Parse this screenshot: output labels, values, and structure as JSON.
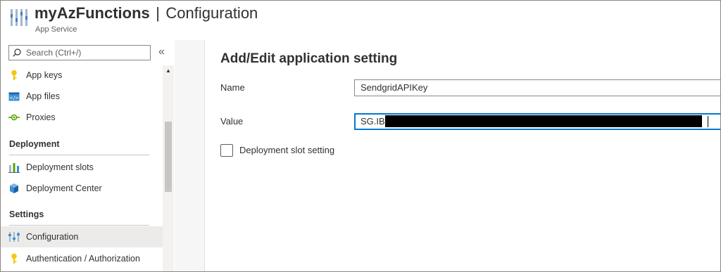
{
  "header": {
    "app_name": "myAzFunctions",
    "separator": "|",
    "page_name": "Configuration",
    "subtitle": "App Service"
  },
  "sidebar": {
    "search_placeholder": "Search (Ctrl+/)",
    "collapse_glyph": "«",
    "items_top": [
      {
        "label": "App keys",
        "icon": "key-icon"
      },
      {
        "label": "App files",
        "icon": "code-file-icon"
      },
      {
        "label": "Proxies",
        "icon": "proxy-icon"
      }
    ],
    "sections": [
      {
        "title": "Deployment",
        "items": [
          {
            "label": "Deployment slots",
            "icon": "deployment-slots-icon"
          },
          {
            "label": "Deployment Center",
            "icon": "deployment-center-icon"
          }
        ]
      },
      {
        "title": "Settings",
        "items": [
          {
            "label": "Configuration",
            "icon": "configuration-icon",
            "selected": true
          },
          {
            "label": "Authentication / Authorization",
            "icon": "key-icon"
          }
        ]
      }
    ]
  },
  "panel": {
    "title": "Add/Edit application setting",
    "name_label": "Name",
    "name_value": "SendgridAPIKey",
    "value_label": "Value",
    "value_visible": "SG.IB",
    "checkbox_label": "Deployment slot setting",
    "checkbox_checked": false
  },
  "colors": {
    "accent": "#0078d4",
    "selected_bg": "#edebe9",
    "key_icon": "#f2c811",
    "proxy_icon": "#57a300"
  }
}
